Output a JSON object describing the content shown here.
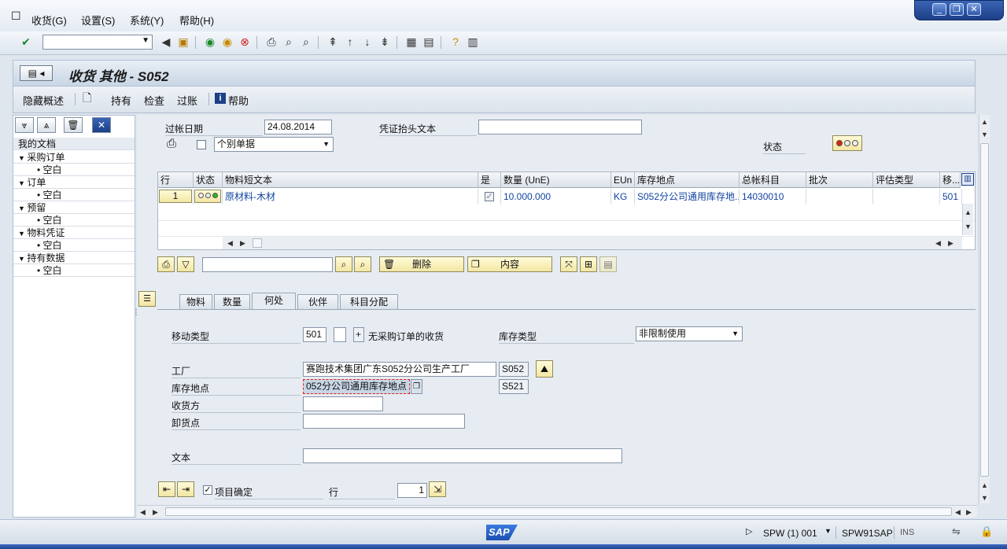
{
  "menu": {
    "items": [
      "收货(G)",
      "设置(S)",
      "系统(Y)",
      "帮助(H)"
    ]
  },
  "title": "收货 其他 - S052",
  "app_toolbar": {
    "hide_overview": "隐藏概述",
    "hold": "持有",
    "check": "检查",
    "post": "过账",
    "help": "帮助"
  },
  "tree": {
    "header": "我的文档",
    "nodes": [
      {
        "label": "采购订单",
        "child": "空白"
      },
      {
        "label": "订单",
        "child": "空白"
      },
      {
        "label": "预留",
        "child": "空白"
      },
      {
        "label": "物料凭证",
        "child": "空白"
      },
      {
        "label": "持有数据",
        "child": "空白"
      }
    ]
  },
  "header": {
    "posting_date_label": "过帐日期",
    "posting_date": "24.08.2014",
    "doc_header_label": "凭证抬头文本",
    "doc_header_value": "",
    "slip_type": "个别单据",
    "status_label": "状态"
  },
  "grid": {
    "columns": [
      "行",
      "状态",
      "物料短文本",
      "是",
      "数量 (UnE)",
      "EUn",
      "库存地点",
      "总帐科目",
      "批次",
      "评估类型",
      "移..."
    ],
    "rows": [
      {
        "line": "1",
        "material": "原材料-木材",
        "qty": "10.000.000",
        "unit": "KG",
        "sloc": "S052分公司通用库存地...",
        "gl": "14030010",
        "batch": "",
        "val_type": "",
        "mvt": "501"
      }
    ]
  },
  "grid_toolbar": {
    "delete": "删除",
    "content": "内容"
  },
  "tabs": [
    "物料",
    "数量",
    "何处",
    "伙伴",
    "科目分配"
  ],
  "where_tab": {
    "movement_type_label": "移动类型",
    "movement_type": "501",
    "movement_text": "无采购订单的收货",
    "movement_plus": "+",
    "stock_type_label": "库存类型",
    "stock_type": "非限制使用",
    "plant_label": "工厂",
    "plant_name": "赛跑技术集团广东S052分公司生产工厂",
    "plant_code": "S052",
    "sloc_label": "库存地点",
    "sloc_name": "052分公司通用库存地点",
    "sloc_code": "S521",
    "recipient_label": "收货方",
    "unloading_label": "卸货点",
    "text_label": "文本"
  },
  "footer": {
    "item_ok_label": "项目确定",
    "line_label": "行",
    "line_value": "1"
  },
  "status_bar": {
    "sap_logo": "SAP",
    "system": "SPW (1) 001",
    "server": "SPW91SAP",
    "mode": "INS"
  },
  "colors": {
    "accent": "#2c57a8",
    "yellow_button": "#f3e6a3",
    "link_blue": "#1244a0"
  }
}
